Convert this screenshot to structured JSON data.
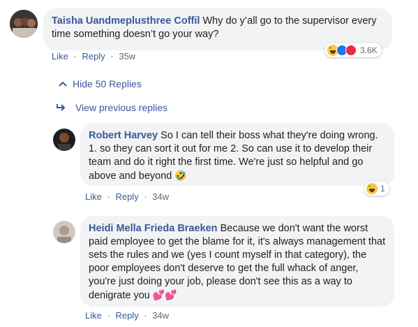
{
  "comment1": {
    "author": "Taisha Uandmeplusthree Coffil",
    "text": "Why do y’all go to the supervisor every time something doesn’t go your way?",
    "like": "Like",
    "reply": "Reply",
    "time": "35w",
    "reaction_count": "3.6K"
  },
  "hide_replies": "Hide 50 Replies",
  "view_previous": "View previous replies",
  "comment2": {
    "author": "Robert Harvey",
    "text": "So I can tell their boss what they're doing wrong. 1. so they can sort it out for me 2. So can use it to develop their team and do it right the first time. We're just so helpful and go above and beyond",
    "emoji": "🤣",
    "like": "Like",
    "reply": "Reply",
    "time": "34w",
    "reaction_count": "1"
  },
  "comment3": {
    "author": "Heidi Mella Frieda Braeken",
    "text": "Because we don't want the worst paid employee to get the blame for it, it's always management that sets the rules and we (yes I count myself in that category), the poor employees don't deserve to get the full whack of anger, you're just doing your job, please don't see this as a way to denigrate you",
    "emoji": "💕💕",
    "like": "Like",
    "reply": "Reply",
    "time": "34w"
  },
  "separator": "·",
  "icons": {
    "hide": "chevron-up-icon",
    "view": "reply-arrow-icon"
  }
}
